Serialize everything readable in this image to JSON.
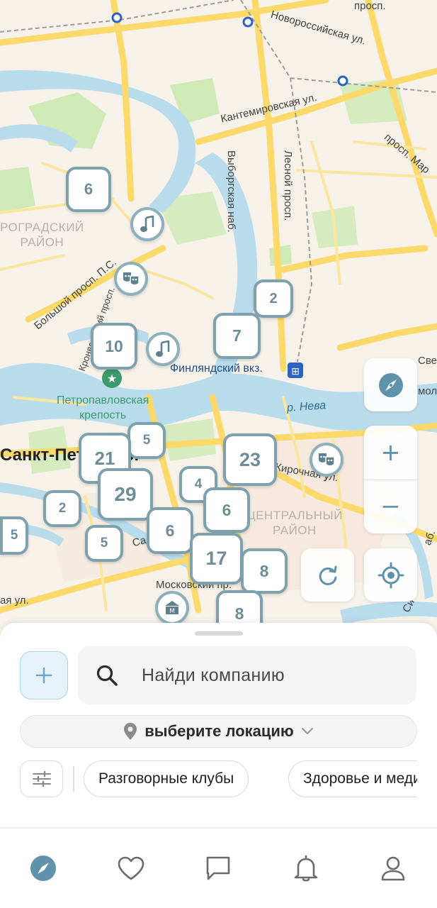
{
  "map": {
    "streets": [
      {
        "id": "novorossiyskaya",
        "text": "Новороссийская ул."
      },
      {
        "id": "prosp-top",
        "text": "просп."
      },
      {
        "id": "kantemirovskaya",
        "text": "Кантемировская ул."
      },
      {
        "id": "prosp-mar",
        "text": "просп. Мар"
      },
      {
        "id": "vyborgskaya",
        "text": "Выборгская наб."
      },
      {
        "id": "lesnoy",
        "text": "Лесной просп."
      },
      {
        "id": "bolshoy",
        "text": "Большой просп. П.С."
      },
      {
        "id": "kronverksky",
        "text": "Кронверкский просп."
      },
      {
        "id": "kirochnaya",
        "text": "Кирочная ул."
      },
      {
        "id": "sa",
        "text": "Са"
      },
      {
        "id": "moskovsky",
        "text": "Московский пр."
      },
      {
        "id": "aya-ul",
        "text": "ая ул."
      },
      {
        "id": "sve",
        "text": "Све"
      },
      {
        "id": "molo",
        "text": "моло"
      },
      {
        "id": "ab",
        "text": "аб."
      },
      {
        "id": "sin",
        "text": "Си"
      }
    ],
    "districts": [
      {
        "id": "petrogradsky",
        "text": "РОГРАДСКИЙ\nРАЙОН"
      },
      {
        "id": "tsentralny",
        "text": "ЦЕНТРАЛЬНЫЙ\nРАЙОН"
      }
    ],
    "city_label": "Санкт-Петербург",
    "park_label": "Петропавловская\nкрепость",
    "river_label": "р. Нева",
    "station_label": "Финляндский вкз.",
    "clusters": [
      {
        "id": "c6a",
        "value": "6"
      },
      {
        "id": "c2a",
        "value": "2"
      },
      {
        "id": "c7",
        "value": "7"
      },
      {
        "id": "c10",
        "value": "10"
      },
      {
        "id": "c5a",
        "value": "5"
      },
      {
        "id": "c21",
        "value": "21"
      },
      {
        "id": "c23",
        "value": "23"
      },
      {
        "id": "c29",
        "value": "29"
      },
      {
        "id": "c4",
        "value": "4"
      },
      {
        "id": "c2b",
        "value": "2"
      },
      {
        "id": "c6b",
        "value": "6"
      },
      {
        "id": "c5b",
        "value": "5"
      },
      {
        "id": "c6c",
        "value": "6"
      },
      {
        "id": "c5c",
        "value": "5"
      },
      {
        "id": "c17",
        "value": "17"
      },
      {
        "id": "c8a",
        "value": "8"
      },
      {
        "id": "c8b",
        "value": "8"
      }
    ],
    "pins": [
      {
        "id": "music-1",
        "icon": "music-note-icon"
      },
      {
        "id": "theatre-1",
        "icon": "theatre-masks-icon"
      },
      {
        "id": "music-2",
        "icon": "music-note-icon"
      },
      {
        "id": "theatre-2",
        "icon": "theatre-masks-icon"
      },
      {
        "id": "museum-1",
        "icon": "museum-icon"
      }
    ],
    "controls": {
      "compass_icon": "compass-icon",
      "zoom_in_label": "+",
      "zoom_out_label": "−",
      "refresh_icon": "refresh-icon",
      "locate_icon": "crosshair-locate-icon"
    }
  },
  "sheet": {
    "add_icon": "plus-icon",
    "search": {
      "placeholder": "Найди компанию",
      "icon": "search-icon"
    },
    "location": {
      "label": "выберите локацию",
      "pin_icon": "location-pin-icon",
      "chevron_icon": "chevron-down-icon"
    },
    "filter_icon": "sliders-icon",
    "chips": [
      {
        "label": "Разговорные клубы"
      },
      {
        "label": "Здоровье и медицина"
      }
    ]
  },
  "tabbar": {
    "items": [
      {
        "id": "explore",
        "icon": "compass-icon",
        "active": true
      },
      {
        "id": "favorites",
        "icon": "heart-icon",
        "active": false
      },
      {
        "id": "messages",
        "icon": "chat-bubble-icon",
        "active": false
      },
      {
        "id": "notifications",
        "icon": "bell-icon",
        "active": false
      },
      {
        "id": "profile",
        "icon": "person-icon",
        "active": false
      }
    ]
  },
  "colors": {
    "cluster_border": "#7fa0ad",
    "cluster_text": "#6e8d98",
    "water": "#b9dced",
    "road": "#fbd96a",
    "park": "#cfe9b7",
    "accent": "#5f93ab"
  }
}
